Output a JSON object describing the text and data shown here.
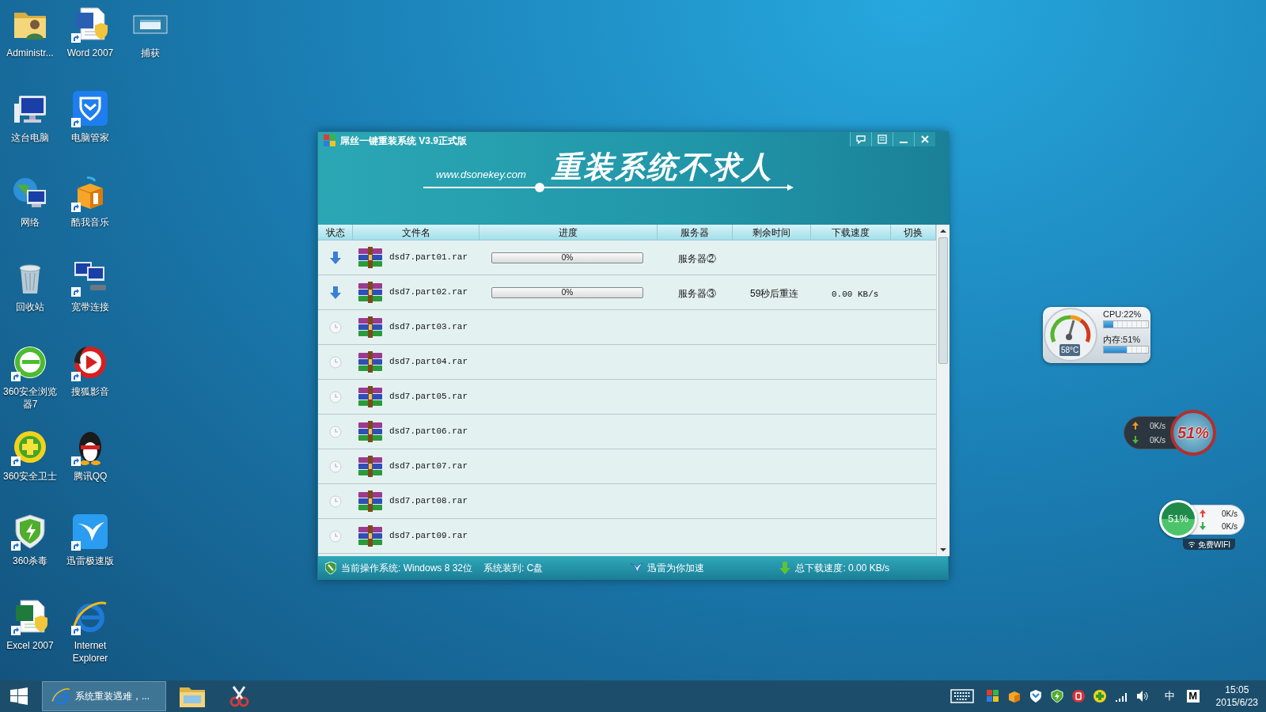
{
  "desktop_icon_rows": [
    [
      {
        "label": "Administr...",
        "shortcut": false
      },
      {
        "label": "Word 2007",
        "shortcut": true
      },
      {
        "label": "捕获",
        "shortcut": false
      }
    ],
    [
      {
        "label": "这台电脑",
        "shortcut": false
      },
      {
        "label": "电脑管家",
        "shortcut": true
      }
    ],
    [
      {
        "label": "网络",
        "shortcut": false
      },
      {
        "label": "酷我音乐",
        "shortcut": true
      }
    ],
    [
      {
        "label": "回收站",
        "shortcut": false
      },
      {
        "label": "宽带连接",
        "shortcut": true
      }
    ],
    [
      {
        "label": "360安全浏览器7",
        "shortcut": true
      },
      {
        "label": "搜狐影音",
        "shortcut": true
      }
    ],
    [
      {
        "label": "360安全卫士",
        "shortcut": true
      },
      {
        "label": "腾讯QQ",
        "shortcut": true
      }
    ],
    [
      {
        "label": "360杀毒",
        "shortcut": true
      },
      {
        "label": "迅雷极速版",
        "shortcut": true
      }
    ],
    [
      {
        "label": "Excel 2007",
        "shortcut": true
      },
      {
        "label": "Internet Explorer",
        "shortcut": true
      }
    ]
  ],
  "window": {
    "title": "屌丝一键重装系统 V3.9正式版",
    "banner": {
      "url": "www.dsonekey.com",
      "slogan": "重装系统不求人"
    },
    "table": {
      "columns": [
        "状态",
        "文件名",
        "进度",
        "服务器",
        "剩余时间",
        "下载速度",
        "切换"
      ],
      "rows": [
        {
          "kind": "downloading",
          "file": "dsd7.part01.rar",
          "progress": {
            "level": 0,
            "text": "0%"
          },
          "server": "服务器②"
        },
        {
          "kind": "downloading",
          "file": "dsd7.part02.rar",
          "progress": {
            "level": 0,
            "text": "0%"
          },
          "server": "服务器③",
          "remaining": "59秒后重连",
          "speed": "0.00 KB/s"
        },
        {
          "kind": "waiting",
          "file": "dsd7.part03.rar"
        },
        {
          "kind": "waiting",
          "file": "dsd7.part04.rar"
        },
        {
          "kind": "waiting",
          "file": "dsd7.part05.rar"
        },
        {
          "kind": "waiting",
          "file": "dsd7.part06.rar"
        },
        {
          "kind": "waiting",
          "file": "dsd7.part07.rar"
        },
        {
          "kind": "waiting",
          "file": "dsd7.part08.rar"
        },
        {
          "kind": "waiting",
          "file": "dsd7.part09.rar"
        }
      ]
    },
    "status_bar": {
      "os": "当前操作系统: Windows 8 32位",
      "target": "系统装到: C盘",
      "accelerate": "迅雷为你加速",
      "total_speed": "总下载速度: 0.00 KB/s"
    }
  },
  "system_monitor_widget": {
    "temperature": "58°C",
    "cpu": {
      "label": "CPU:22%",
      "level": 0.22
    },
    "memory": {
      "label": "内存:51%",
      "level": 0.51
    }
  },
  "network_widget": {
    "upload": "0K/s",
    "download": "0K/s",
    "badge": "51%"
  },
  "wifi_widget": {
    "percent": "51%",
    "upload": "0K/s",
    "download": "0K/s",
    "label": "免费WIFI"
  },
  "taskbar": {
    "tasks": [
      {
        "label": "系统重装遇难，...",
        "selected": true
      }
    ],
    "ime": "中",
    "ime_mode": "M",
    "time": "15:05",
    "date": "2015/6/23"
  }
}
